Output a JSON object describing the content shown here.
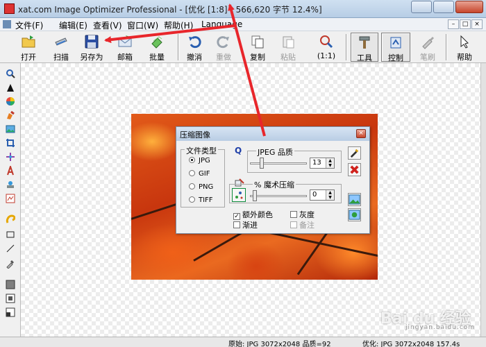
{
  "window": {
    "title": "xat.com  Image Optimizer Professional - [优化 [1:8] - 566,620 字节 12.4%]"
  },
  "menubar": {
    "items": [
      "文件(F)",
      "编辑(E)",
      "查看(V)",
      "窗口(W)",
      "帮助(H)",
      "Language"
    ]
  },
  "toolbar": {
    "open": "打开",
    "scan": "扫描",
    "save_as": "另存为",
    "mail": "邮箱",
    "batch": "批量",
    "undo": "撤消",
    "redo": "重做",
    "copy": "复制",
    "paste": "粘贴",
    "zoom": "(1:1)",
    "tools": "工具",
    "control": "控制",
    "brush": "笔刷",
    "help": "帮助"
  },
  "dialog": {
    "title": "压缩图像",
    "file_type": {
      "legend": "文件类型",
      "options": [
        "JPG",
        "GIF",
        "PNG",
        "TIFF"
      ],
      "selected": "JPG"
    },
    "jpeg_quality": {
      "letter": "Q",
      "legend": "JPEG 品质",
      "value": "13",
      "level": 0.13
    },
    "magic": {
      "legend": "% 魔术压缩",
      "value": "0",
      "level": 0.0
    },
    "checkboxes": {
      "extra_colors": "额外颜色",
      "grayscale": "灰度",
      "progressive": "渐进",
      "notes": "备注"
    }
  },
  "statusbar": {
    "original": "原始: JPG 3072x2048  品质=92",
    "optimized": "优化: JPG 3072x2048  157.4s"
  },
  "watermark": {
    "text": "Bai du 经验",
    "sub": "jingyan.baidu.com"
  },
  "colors": {
    "arrow": "#e8262b",
    "titlebar": "#c3d6ec"
  }
}
